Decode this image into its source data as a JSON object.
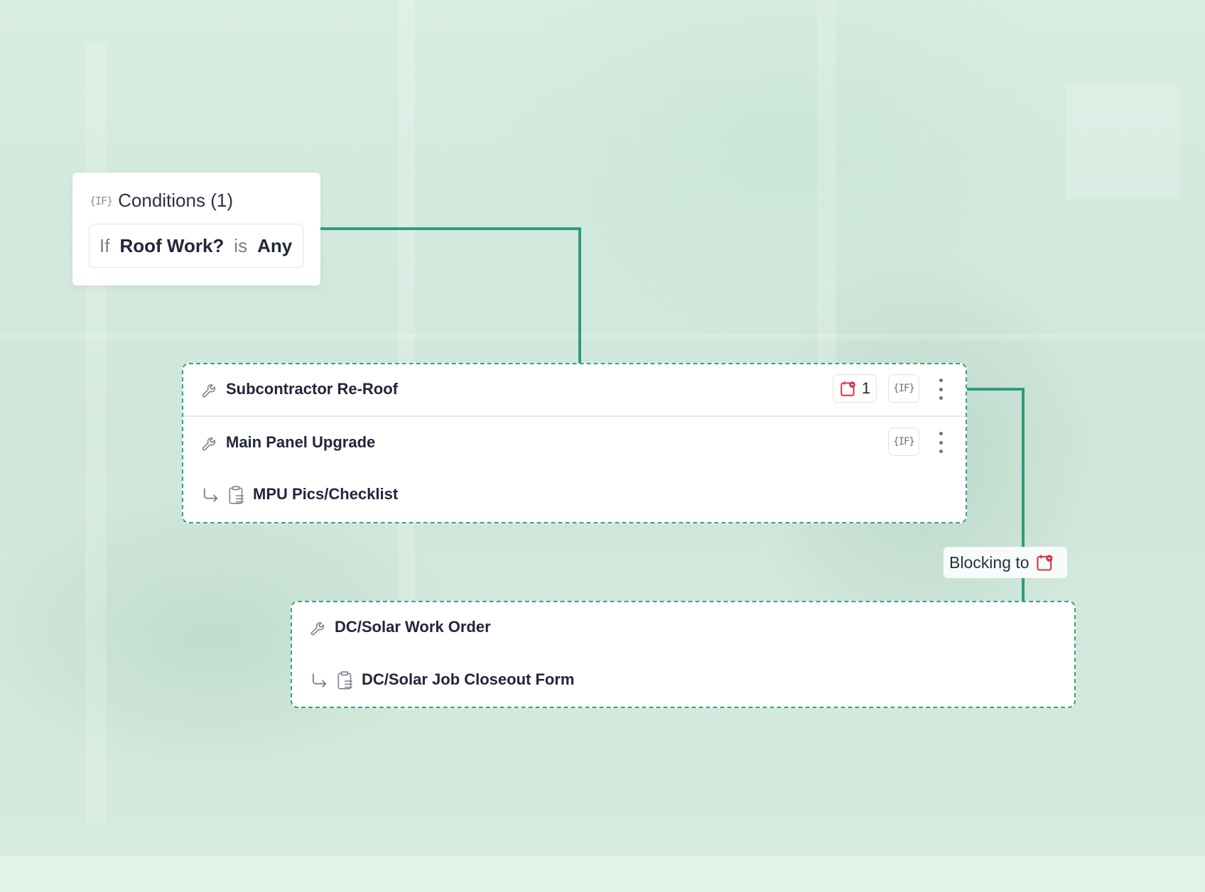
{
  "conditions": {
    "title": "Conditions (1)",
    "if_icon": "{IF}",
    "rule": {
      "if_word": "If",
      "field": "Roof Work?",
      "operator": "is",
      "value": "Any"
    }
  },
  "group1": {
    "rows": [
      {
        "title": "Subcontractor Re-Roof",
        "icon": "wrench-icon",
        "blocking_count": "1",
        "condition_icon": "{IF}"
      },
      {
        "title": "Main Panel Upgrade",
        "icon": "wrench-icon",
        "condition_icon": "{IF}"
      },
      {
        "title": "MPU Pics/Checklist",
        "icon": "clipboard-icon",
        "child": true
      }
    ]
  },
  "blocking": {
    "label": "Blocking to",
    "icon": "blocking-calendar-icon"
  },
  "group2": {
    "rows": [
      {
        "title": "DC/Solar Work Order",
        "icon": "wrench-icon"
      },
      {
        "title": "DC/Solar Job Closeout Form",
        "icon": "clipboard-icon",
        "child": true
      }
    ]
  },
  "colors": {
    "connector": "#2f9b80",
    "dashed_border": "#35a48a",
    "blocking_red": "#d6334a",
    "text_dark": "#22263a"
  }
}
